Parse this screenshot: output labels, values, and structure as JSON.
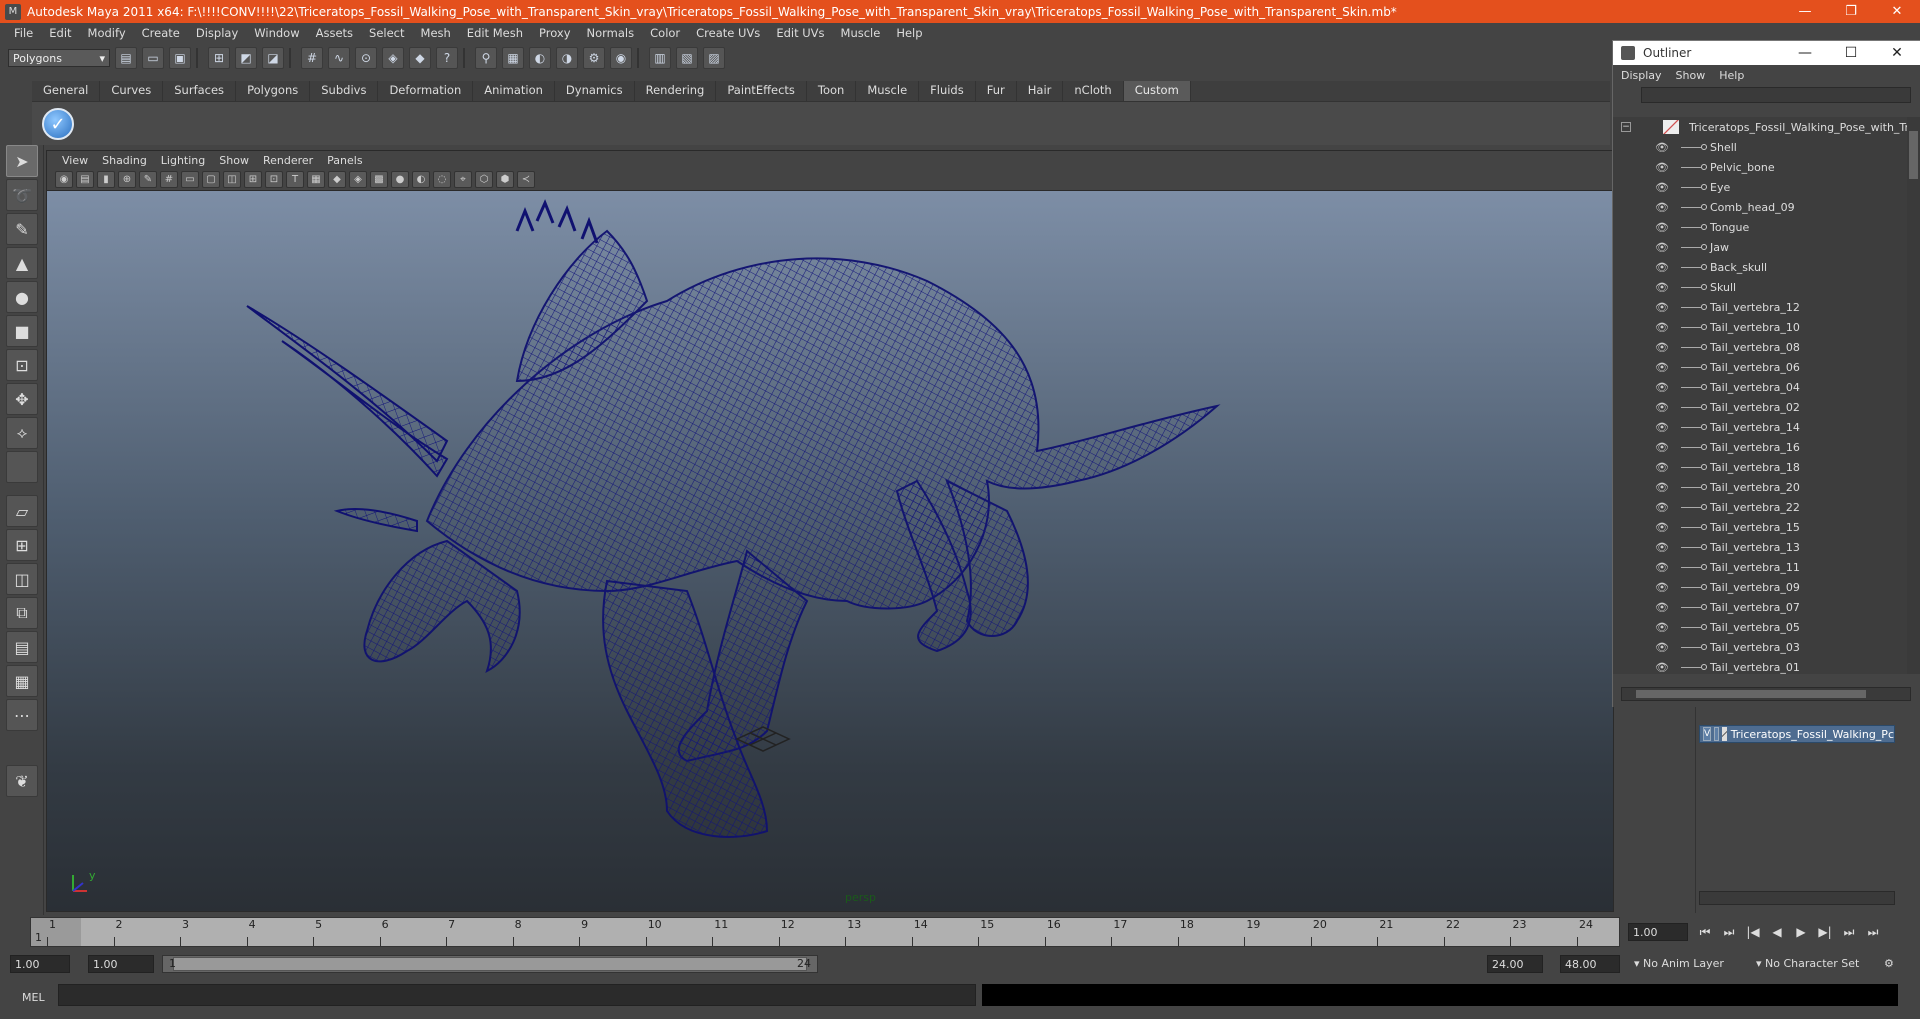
{
  "titlebar": {
    "title": "Autodesk Maya 2011 x64: F:\\!!!!CONV!!!!\\22\\Triceratops_Fossil_Walking_Pose_with_Transparent_Skin_vray\\Triceratops_Fossil_Walking_Pose_with_Transparent_Skin_vray\\Triceratops_Fossil_Walking_Pose_with_Transparent_Skin.mb*",
    "minimize": "—",
    "restore": "❐",
    "close": "✕"
  },
  "menubar": [
    "File",
    "Edit",
    "Modify",
    "Create",
    "Display",
    "Window",
    "Assets",
    "Select",
    "Mesh",
    "Edit Mesh",
    "Proxy",
    "Normals",
    "Color",
    "Create UVs",
    "Edit UVs",
    "Muscle",
    "Help"
  ],
  "statusline": {
    "mode": "Polygons"
  },
  "shelf": {
    "tabs": [
      "General",
      "Curves",
      "Surfaces",
      "Polygons",
      "Subdivs",
      "Deformation",
      "Animation",
      "Dynamics",
      "Rendering",
      "PaintEffects",
      "Toon",
      "Muscle",
      "Fluids",
      "Fur",
      "Hair",
      "nCloth",
      "Custom"
    ],
    "active_tab": "Custom"
  },
  "viewport": {
    "menu": [
      "View",
      "Shading",
      "Lighting",
      "Show",
      "Renderer",
      "Panels"
    ],
    "camera_label": "persp",
    "axis_y": "y",
    "wire_color": "#14157a"
  },
  "outliner": {
    "title": "Outliner",
    "menu": [
      "Display",
      "Show",
      "Help"
    ],
    "root": "Triceratops_Fossil_Walking_Pose_with_Trans",
    "items": [
      "Shell",
      "Pelvic_bone",
      "Eye",
      "Comb_head_09",
      "Tongue",
      "Jaw",
      "Back_skull",
      "Skull",
      "Tail_vertebra_12",
      "Tail_vertebra_10",
      "Tail_vertebra_08",
      "Tail_vertebra_06",
      "Tail_vertebra_04",
      "Tail_vertebra_02",
      "Tail_vertebra_14",
      "Tail_vertebra_16",
      "Tail_vertebra_18",
      "Tail_vertebra_20",
      "Tail_vertebra_22",
      "Tail_vertebra_15",
      "Tail_vertebra_13",
      "Tail_vertebra_11",
      "Tail_vertebra_09",
      "Tail_vertebra_07",
      "Tail_vertebra_05",
      "Tail_vertebra_03",
      "Tail_vertebra_01"
    ]
  },
  "layers": {
    "layer_name": "Triceratops_Fossil_Walking_Pc",
    "visible_flag": "V"
  },
  "timeline": {
    "ticks": [
      "1",
      "2",
      "3",
      "4",
      "5",
      "6",
      "7",
      "8",
      "9",
      "10",
      "11",
      "12",
      "13",
      "14",
      "15",
      "16",
      "17",
      "18",
      "19",
      "20",
      "21",
      "22",
      "23",
      "24"
    ],
    "current_frame": "1",
    "current_field": "1.00"
  },
  "range": {
    "start_time": "1.00",
    "playback_start": "1.00",
    "slider_start": "1",
    "slider_end": "24",
    "playback_end": "24.00",
    "end_time": "48.00",
    "anim_layer": "No Anim Layer",
    "char_set": "No Character Set"
  },
  "command": {
    "label": "MEL"
  }
}
